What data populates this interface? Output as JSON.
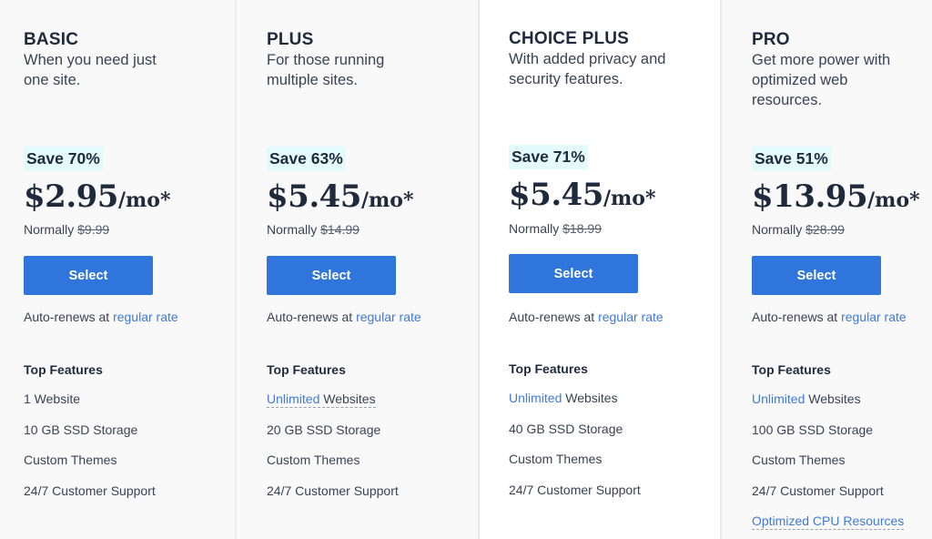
{
  "plans": [
    {
      "name": "BASIC",
      "description": "When you need just one site.",
      "save_badge": "Save 70%",
      "price": "$2.95",
      "per": "/mo*",
      "normally_label": "Normally",
      "normal_price": "$9.99",
      "select_label": "Select",
      "autorenew_text": "Auto-renews at",
      "autorenew_link": "regular rate",
      "features_title": "Top Features",
      "features": [
        {
          "highlight": "",
          "text": "1 Website",
          "dotted": false
        },
        {
          "highlight": "",
          "text": "10 GB SSD Storage",
          "dotted": false
        },
        {
          "highlight": "",
          "text": "Custom Themes",
          "dotted": false
        },
        {
          "highlight": "",
          "text": "24/7 Customer Support",
          "dotted": false
        }
      ]
    },
    {
      "name": "PLUS",
      "description": "For those running multiple sites.",
      "save_badge": "Save 63%",
      "price": "$5.45",
      "per": "/mo*",
      "normally_label": "Normally",
      "normal_price": "$14.99",
      "select_label": "Select",
      "autorenew_text": "Auto-renews at",
      "autorenew_link": "regular rate",
      "features_title": "Top Features",
      "features": [
        {
          "highlight": "Unlimited",
          "text": " Websites",
          "dotted": true
        },
        {
          "highlight": "",
          "text": "20 GB SSD Storage",
          "dotted": false
        },
        {
          "highlight": "",
          "text": "Custom Themes",
          "dotted": false
        },
        {
          "highlight": "",
          "text": "24/7 Customer Support",
          "dotted": false
        }
      ]
    },
    {
      "name": "CHOICE PLUS",
      "description": "With added privacy and security features.",
      "save_badge": "Save 71%",
      "price": "$5.45",
      "per": "/mo*",
      "normally_label": "Normally",
      "normal_price": "$18.99",
      "select_label": "Select",
      "autorenew_text": "Auto-renews at",
      "autorenew_link": "regular rate",
      "features_title": "Top Features",
      "features": [
        {
          "highlight": "Unlimited",
          "text": " Websites",
          "dotted": false
        },
        {
          "highlight": "",
          "text": "40 GB SSD Storage",
          "dotted": false
        },
        {
          "highlight": "",
          "text": "Custom Themes",
          "dotted": false
        },
        {
          "highlight": "",
          "text": "24/7 Customer Support",
          "dotted": false
        }
      ]
    },
    {
      "name": "PRO",
      "description": "Get more power with optimized web resources.",
      "save_badge": "Save 51%",
      "price": "$13.95",
      "per": "/mo*",
      "normally_label": "Normally",
      "normal_price": "$28.99",
      "select_label": "Select",
      "autorenew_text": "Auto-renews at",
      "autorenew_link": "regular rate",
      "features_title": "Top Features",
      "features": [
        {
          "highlight": "Unlimited",
          "text": " Websites",
          "dotted": false
        },
        {
          "highlight": "",
          "text": "100 GB SSD Storage",
          "dotted": false
        },
        {
          "highlight": "",
          "text": "Custom Themes",
          "dotted": false
        },
        {
          "highlight": "",
          "text": "24/7 Customer Support",
          "dotted": false
        },
        {
          "highlight": "Optimized CPU Resources",
          "text": "",
          "dotted": true
        }
      ]
    }
  ],
  "colors": {
    "accent": "#2f75dc",
    "link": "#3f7ad8",
    "save_badge_bg": "#e4fbfe",
    "text_dark": "#1f2a3c"
  }
}
